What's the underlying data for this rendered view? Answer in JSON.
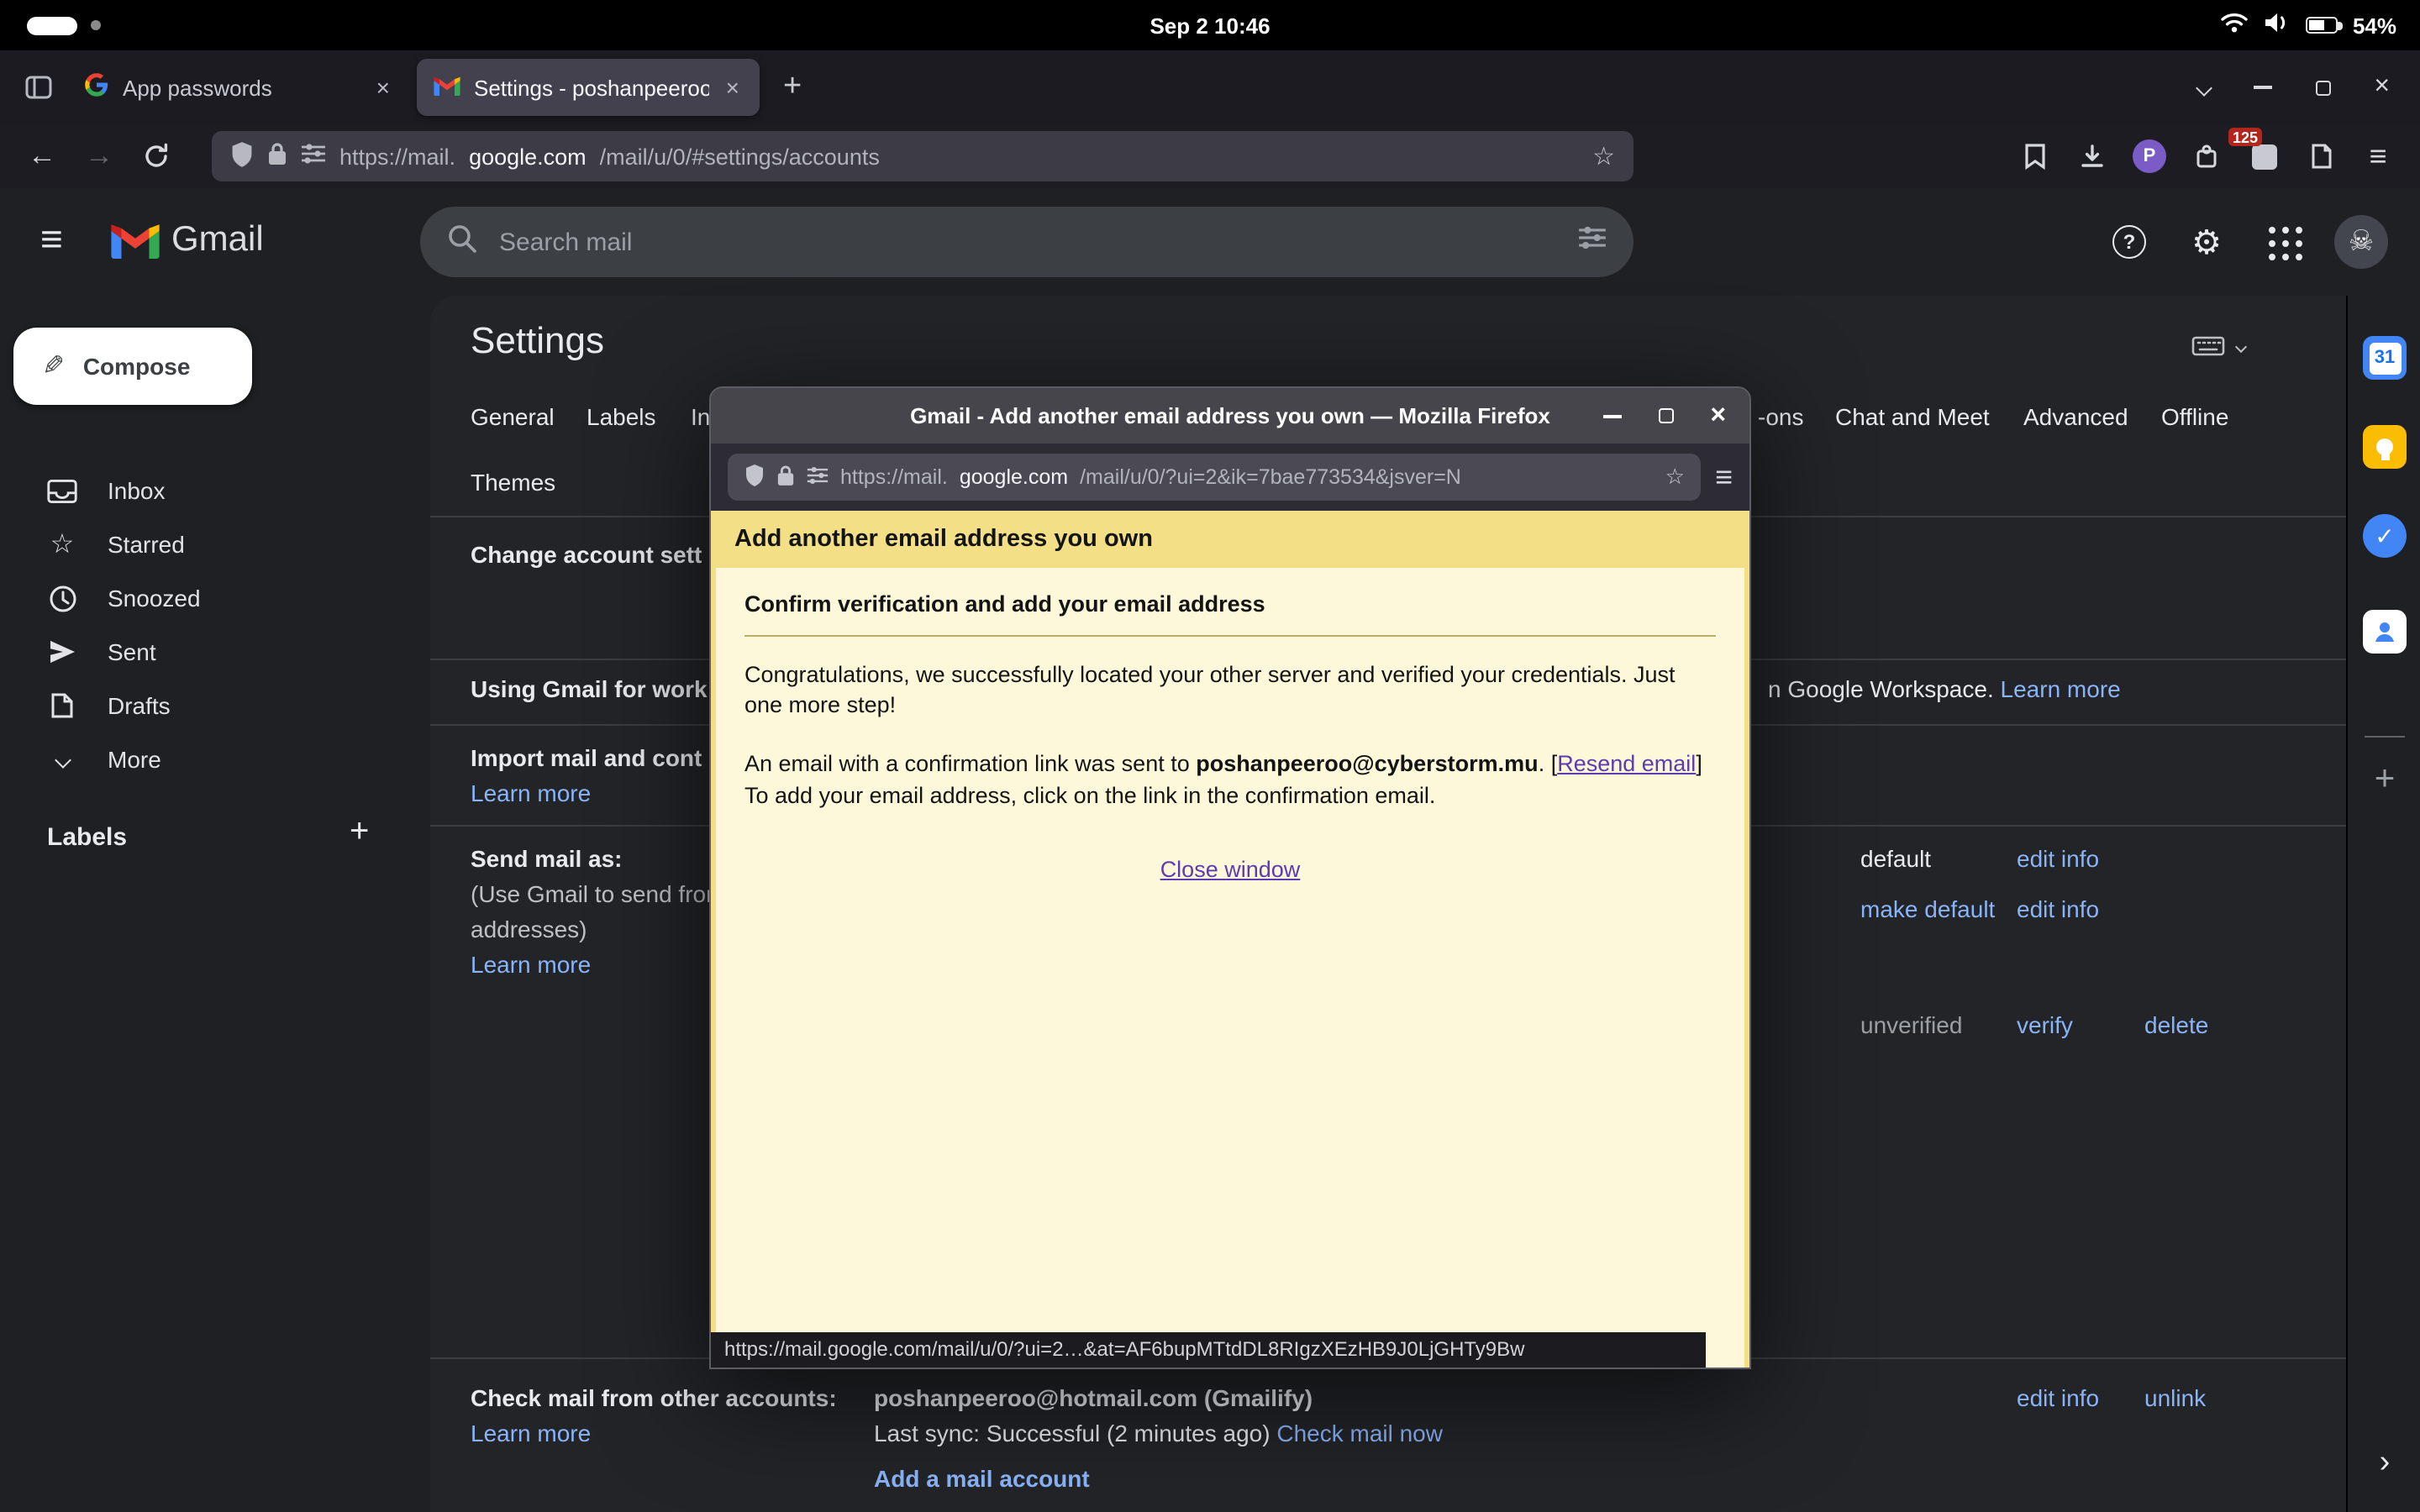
{
  "glyphs": {
    "close": "×",
    "plus": "+",
    "hamburger": "≡",
    "gear": "⚙",
    "star": "☆",
    "skull": "☠",
    "question": "?",
    "pencil": "✎",
    "check": "✓",
    "back": "←",
    "forward": "→",
    "chevron_right": "›"
  },
  "system_bar": {
    "clock": "Sep 2  10:46",
    "battery": "54%"
  },
  "browser": {
    "tabs": [
      {
        "title": "App passwords"
      },
      {
        "title": "Settings - poshanpeeroo"
      }
    ],
    "url_scheme": "https://mail.",
    "url_domain": "google.com",
    "url_path": "/mail/u/0/#settings/accounts",
    "ext_badge": "125",
    "profile_initial": "P"
  },
  "gmail": {
    "brand": "Gmail",
    "search_placeholder": "Search mail",
    "compose_label": "Compose",
    "nav": [
      {
        "label": "Inbox"
      },
      {
        "label": "Starred"
      },
      {
        "label": "Snoozed"
      },
      {
        "label": "Sent"
      },
      {
        "label": "Drafts"
      },
      {
        "label": "More"
      }
    ],
    "labels_title": "Labels",
    "settings": {
      "title": "Settings",
      "tabs_left": [
        "General",
        "Labels",
        "In"
      ],
      "tabs_right": [
        "-ons",
        "Chat and Meet",
        "Advanced",
        "Offline"
      ],
      "tab_themes": "Themes",
      "change_account": "Change account sett",
      "using_gmail": "Using Gmail for work",
      "workspace_text": "n Google Workspace.",
      "workspace_link": "Learn more",
      "import_label": "Import mail and cont",
      "import_link": "Learn more",
      "send_mail_as": "Send mail as:",
      "send_desc_1": "(Use Gmail to send from y",
      "send_desc_2": "addresses)",
      "send_link": "Learn more",
      "default_status": "default",
      "default_action": "edit info",
      "make_default": "make default",
      "make_default_action": "edit info",
      "unverified_status": "unverified",
      "verify_action": "verify",
      "delete_action": "delete",
      "check_mail_label": "Check mail from other accounts:",
      "check_mail_learn": "Learn more",
      "account_name": "poshanpeeroo@hotmail.com (Gmailify)",
      "last_sync": "Last sync: Successful (2 minutes ago)",
      "check_now": "Check mail now",
      "edit_info": "edit info",
      "unlink": "unlink",
      "add_account": "Add a mail account"
    },
    "side_panel": {
      "calendar_day": "31"
    }
  },
  "popup": {
    "title": "Gmail - Add another email address you own — Mozilla Firefox",
    "url_scheme": "https://mail.",
    "url_domain": "google.com",
    "url_path": "/mail/u/0/?ui=2&ik=7bae773534&jsver=N",
    "banner": "Add another email address you own",
    "heading": "Confirm verification and add your email address",
    "p1": "Congratulations, we successfully located your other server and verified your credentials. Just one more step!",
    "p2_before": "An email with a confirmation link was sent to ",
    "p2_email": "poshanpeeroo@cyberstorm.mu",
    "p2_dot": ". [",
    "resend": "Resend email",
    "p2_bracket": "]",
    "p2_line2": "To add your email address, click on the link in the confirmation email.",
    "close_window": "Close window",
    "status_url": "https://mail.google.com/mail/u/0/?ui=2…&at=AF6bupMTtdDL8RIgzXEzHB9J0LjGHTy9Bw"
  }
}
